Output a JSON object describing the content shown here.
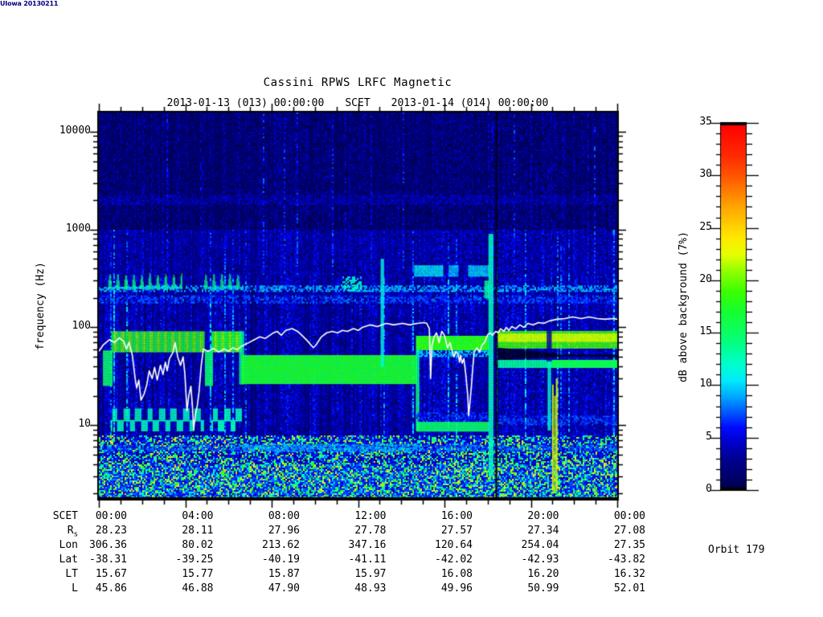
{
  "header": {
    "title": "Cassini RPWS LRFC Magnetic",
    "scet_left": "2013-01-13 (013) 00:00:00",
    "scet_label": "SCET",
    "scet_right": "2013-01-14 (014) 00:00:00"
  },
  "y_axis": {
    "label": "frequency (Hz)",
    "ticks": [
      {
        "value": 10000,
        "label": "10000"
      },
      {
        "value": 1000,
        "label": "1000"
      },
      {
        "value": 100,
        "label": "100"
      },
      {
        "value": 10,
        "label": "10"
      }
    ]
  },
  "colorbar": {
    "label": "dB above background (7%)",
    "range": [
      0,
      35
    ],
    "major_tick_step": 5,
    "minor_tick_step": 1,
    "tick_labels": [
      {
        "value": 35,
        "label": "35"
      },
      {
        "value": 30,
        "label": "30"
      },
      {
        "value": 25,
        "label": "25"
      },
      {
        "value": 20,
        "label": "20"
      },
      {
        "value": 15,
        "label": "15"
      },
      {
        "value": 10,
        "label": "10"
      },
      {
        "value": 5,
        "label": "5"
      },
      {
        "value": 0,
        "label": "0"
      }
    ]
  },
  "ephemeris_table": {
    "rows": [
      {
        "label": "SCET",
        "values": [
          "00:00",
          "04:00",
          "08:00",
          "12:00",
          "16:00",
          "20:00",
          "00:00"
        ]
      },
      {
        "label": "R",
        "label_sub": "s",
        "values": [
          "28.23",
          "28.11",
          "27.96",
          "27.78",
          "27.57",
          "27.34",
          "27.08"
        ]
      },
      {
        "label": "Lon",
        "values": [
          "306.36",
          "80.02",
          "213.62",
          "347.16",
          "120.64",
          "254.04",
          "27.35"
        ]
      },
      {
        "label": "Lat",
        "values": [
          "-38.31",
          "-39.25",
          "-40.19",
          "-41.11",
          "-42.02",
          "-42.93",
          "-43.82"
        ]
      },
      {
        "label": "LT",
        "values": [
          "15.67",
          "15.77",
          "15.87",
          "15.97",
          "16.08",
          "16.20",
          "16.32"
        ]
      },
      {
        "label": "L",
        "values": [
          "45.86",
          "46.88",
          "47.90",
          "48.93",
          "49.96",
          "50.99",
          "52.01"
        ]
      }
    ]
  },
  "annotations": {
    "orbit": "Orbit 179",
    "credit": "UIowa 20130211"
  },
  "chart_data": {
    "type": "heatmap",
    "title": "Cassini RPWS LRFC Magnetic",
    "xlabel": "SCET",
    "ylabel": "frequency (Hz)",
    "y_scale": "log",
    "x_range_hours": [
      0,
      24
    ],
    "x_major_tick_hours": [
      0,
      4,
      8,
      12,
      16,
      20,
      24
    ],
    "x_minor_tick_step_hours": 1,
    "y_range_hz": [
      1.8,
      15700
    ],
    "colorbar_label": "dB above background (7%)",
    "colorbar_range": [
      0,
      35
    ],
    "palette_stops": [
      [
        0,
        0,
        0,
        70
      ],
      [
        1.2,
        0,
        0,
        105
      ],
      [
        3,
        0,
        0,
        145
      ],
      [
        4.5,
        0,
        0,
        200
      ],
      [
        6,
        0,
        10,
        255
      ],
      [
        7.5,
        0,
        90,
        255
      ],
      [
        9,
        0,
        170,
        255
      ],
      [
        10.5,
        0,
        235,
        250
      ],
      [
        12,
        0,
        255,
        205
      ],
      [
        13.5,
        0,
        255,
        150
      ],
      [
        15,
        10,
        255,
        100
      ],
      [
        17,
        20,
        255,
        50
      ],
      [
        19,
        60,
        255,
        0
      ],
      [
        21,
        150,
        255,
        0
      ],
      [
        22.5,
        230,
        255,
        0
      ],
      [
        24,
        255,
        235,
        0
      ],
      [
        26,
        255,
        190,
        0
      ],
      [
        28,
        255,
        140,
        0
      ],
      [
        30,
        255,
        85,
        0
      ],
      [
        32,
        255,
        40,
        0
      ],
      [
        35,
        255,
        0,
        0
      ]
    ],
    "bands": [
      {
        "t0": 0,
        "t1": 24,
        "f0": 180,
        "f1": 212,
        "db": 7,
        "style": "speckle"
      },
      {
        "t0": 0,
        "t1": 24,
        "f0": 238,
        "f1": 268,
        "db": 9,
        "style": "speckle"
      },
      {
        "t0": 0,
        "t1": 24,
        "f0": 1850,
        "f1": 2250,
        "db": 4.2,
        "style": "speckle"
      },
      {
        "t0": 0,
        "t1": 24,
        "f0": 5.5,
        "f1": 6.3,
        "db": 7.5,
        "style": "speckle"
      },
      {
        "t0": 6.65,
        "t1": 14.72,
        "f0": 5.5,
        "f1": 6.4,
        "db": 9,
        "style": "speckle"
      },
      {
        "t0": 11.2,
        "t1": 12.15,
        "f0": 240,
        "f1": 330,
        "db": 12,
        "style": "speckle"
      },
      {
        "t0": 0.4,
        "t1": 3.85,
        "f0": 250,
        "f1": 362,
        "db": 13,
        "style": "wave",
        "period": 0.37
      },
      {
        "t0": 4.85,
        "t1": 6.7,
        "f0": 250,
        "f1": 362,
        "db": 13,
        "style": "wave",
        "period": 0.37
      },
      {
        "t0": 0.19,
        "t1": 0.63,
        "f0": 26,
        "f1": 58,
        "db": 15,
        "style": "solid"
      },
      {
        "t0": 4.91,
        "t1": 5.28,
        "f0": 26,
        "f1": 58,
        "db": 15,
        "style": "solid"
      },
      {
        "t0": 0.58,
        "t1": 4.84,
        "f0": 57,
        "f1": 91,
        "db": 17,
        "style": "blobs",
        "period": 0.33
      },
      {
        "t0": 5.21,
        "t1": 6.6,
        "f0": 57,
        "f1": 91,
        "db": 17,
        "style": "blobs",
        "period": 0.33
      },
      {
        "t0": 0.55,
        "t1": 4.84,
        "f0": 8.7,
        "f1": 14.8,
        "db": 12.5,
        "style": "sq",
        "period": 0.55
      },
      {
        "t0": 5.21,
        "t1": 6.6,
        "f0": 8.7,
        "f1": 14.8,
        "db": 12.5,
        "style": "sq",
        "period": 0.55
      },
      {
        "t0": 6.5,
        "t1": 6.68,
        "f0": 27,
        "f1": 91,
        "db": 14,
        "style": "solid"
      },
      {
        "t0": 6.62,
        "t1": 14.72,
        "f0": 27,
        "f1": 52,
        "db": 17,
        "style": "solid"
      },
      {
        "t0": 14.68,
        "t1": 14.82,
        "f0": 9,
        "f1": 82,
        "db": 14,
        "style": "solid"
      },
      {
        "t0": 14.7,
        "t1": 18.02,
        "f0": 60,
        "f1": 82,
        "db": 18,
        "style": "solid"
      },
      {
        "t0": 14.7,
        "t1": 18.02,
        "f0": 50,
        "f1": 58,
        "db": 10,
        "style": "speckle"
      },
      {
        "t0": 14.7,
        "t1": 18.02,
        "f0": 11.2,
        "f1": 13.6,
        "db": 6.5,
        "style": "speckle"
      },
      {
        "t0": 14.7,
        "t1": 18.02,
        "f0": 8.8,
        "f1": 10.8,
        "db": 15,
        "style": "solid"
      },
      {
        "t0": 14.6,
        "t1": 15.9,
        "f0": 340,
        "f1": 430,
        "db": 10.5,
        "style": "solid"
      },
      {
        "t0": 16.2,
        "t1": 16.6,
        "f0": 340,
        "f1": 430,
        "db": 9.5,
        "style": "solid"
      },
      {
        "t0": 17.1,
        "t1": 18.0,
        "f0": 340,
        "f1": 430,
        "db": 10,
        "style": "solid"
      },
      {
        "t0": 17.85,
        "t1": 18.05,
        "f0": 200,
        "f1": 300,
        "db": 13.5,
        "style": "solid"
      },
      {
        "t0": 13.05,
        "t1": 13.13,
        "f0": 40,
        "f1": 500,
        "db": 11.5,
        "style": "solid"
      },
      {
        "t0": 18.04,
        "t1": 18.22,
        "f0": 3,
        "f1": 900,
        "db": 12.5,
        "style": "solid"
      },
      {
        "t0": 18.48,
        "t1": 24,
        "f0": 62,
        "f1": 92,
        "db": 19,
        "style": "solid"
      },
      {
        "t0": 18.48,
        "t1": 24,
        "f0": 72,
        "f1": 86,
        "db": 22.5,
        "style": "solid"
      },
      {
        "t0": 18.48,
        "t1": 24,
        "f0": 39,
        "f1": 46.5,
        "db": 13.5,
        "style": "solid"
      },
      {
        "t0": 21,
        "t1": 24,
        "f0": 39,
        "f1": 46.5,
        "db": 16,
        "style": "solid"
      },
      {
        "t0": 18.5,
        "t1": 24,
        "f0": 10,
        "f1": 12.5,
        "db": 7,
        "style": "speckle"
      },
      {
        "t0": 20.74,
        "t1": 20.9,
        "f0": 45,
        "f1": 95,
        "db": 3.5,
        "style": "solid"
      },
      {
        "t0": 20.78,
        "t1": 20.87,
        "f0": 9,
        "f1": 45,
        "db": 12,
        "style": "solid"
      },
      {
        "t0": 20.98,
        "t1": 21.03,
        "f0": 2.2,
        "f1": 26,
        "db": 23,
        "style": "solid"
      },
      {
        "t0": 21.08,
        "t1": 21.12,
        "f0": 2.2,
        "f1": 20,
        "db": 21,
        "style": "solid"
      },
      {
        "t0": 21.16,
        "t1": 21.2,
        "f0": 2.2,
        "f1": 30,
        "db": 23,
        "style": "solid"
      }
    ],
    "black_wedge": {
      "t0": 18.48,
      "t1": 24,
      "taper_end": 21.5,
      "f_top_start": 62,
      "f_bot_start": 46.5,
      "f_top_end": 53,
      "f_bot_end": 50
    },
    "black_line": {
      "t0": 18.36,
      "t1": 18.44
    },
    "speckle_floor_max_hz": 8,
    "white_line_points": [
      [
        0,
        57
      ],
      [
        0.2,
        66
      ],
      [
        0.5,
        75
      ],
      [
        0.72,
        70
      ],
      [
        0.95,
        78
      ],
      [
        1.15,
        72
      ],
      [
        1.28,
        60
      ],
      [
        1.4,
        70
      ],
      [
        1.55,
        52
      ],
      [
        1.68,
        30
      ],
      [
        1.75,
        24
      ],
      [
        1.85,
        29
      ],
      [
        1.95,
        18
      ],
      [
        2.1,
        21
      ],
      [
        2.22,
        26
      ],
      [
        2.33,
        36
      ],
      [
        2.47,
        30
      ],
      [
        2.58,
        39
      ],
      [
        2.7,
        29
      ],
      [
        2.85,
        41
      ],
      [
        2.97,
        33
      ],
      [
        3.08,
        44
      ],
      [
        3.16,
        36
      ],
      [
        3.27,
        48
      ],
      [
        3.42,
        55
      ],
      [
        3.53,
        70
      ],
      [
        3.65,
        50
      ],
      [
        3.78,
        41
      ],
      [
        3.9,
        50
      ],
      [
        3.98,
        34
      ],
      [
        4.08,
        14
      ],
      [
        4.16,
        20
      ],
      [
        4.26,
        25
      ],
      [
        4.33,
        16
      ],
      [
        4.39,
        9
      ],
      [
        4.46,
        12.5
      ],
      [
        4.56,
        16
      ],
      [
        4.64,
        22
      ],
      [
        4.74,
        41
      ],
      [
        4.84,
        60
      ],
      [
        5.05,
        57
      ],
      [
        5.3,
        61
      ],
      [
        5.55,
        56
      ],
      [
        5.8,
        60
      ],
      [
        6.0,
        57
      ],
      [
        6.2,
        62
      ],
      [
        6.4,
        59
      ],
      [
        6.6,
        64
      ],
      [
        6.95,
        70
      ],
      [
        7.2,
        75
      ],
      [
        7.45,
        80
      ],
      [
        7.7,
        77
      ],
      [
        8.05,
        87
      ],
      [
        8.25,
        91
      ],
      [
        8.45,
        83
      ],
      [
        8.65,
        93
      ],
      [
        8.95,
        97
      ],
      [
        9.2,
        91
      ],
      [
        9.4,
        83
      ],
      [
        9.65,
        73
      ],
      [
        9.93,
        62
      ],
      [
        10.05,
        66
      ],
      [
        10.3,
        80
      ],
      [
        10.55,
        88
      ],
      [
        10.8,
        91
      ],
      [
        11.05,
        88
      ],
      [
        11.28,
        93
      ],
      [
        11.5,
        91
      ],
      [
        11.8,
        97
      ],
      [
        12.0,
        93
      ],
      [
        12.2,
        100
      ],
      [
        12.55,
        106
      ],
      [
        12.9,
        102
      ],
      [
        13.3,
        110
      ],
      [
        13.65,
        106
      ],
      [
        14.05,
        110
      ],
      [
        14.4,
        106
      ],
      [
        14.75,
        110
      ],
      [
        15.05,
        112
      ],
      [
        15.18,
        110
      ],
      [
        15.3,
        97
      ],
      [
        15.36,
        30
      ],
      [
        15.42,
        65
      ],
      [
        15.52,
        80
      ],
      [
        15.63,
        88
      ],
      [
        15.75,
        70
      ],
      [
        15.88,
        91
      ],
      [
        16.0,
        83
      ],
      [
        16.14,
        62
      ],
      [
        16.26,
        70
      ],
      [
        16.37,
        55
      ],
      [
        16.45,
        50
      ],
      [
        16.52,
        57
      ],
      [
        16.63,
        53
      ],
      [
        16.7,
        44
      ],
      [
        16.74,
        52
      ],
      [
        16.82,
        43
      ],
      [
        16.9,
        48
      ],
      [
        17.0,
        31
      ],
      [
        17.08,
        20
      ],
      [
        17.12,
        12.5
      ],
      [
        17.19,
        18
      ],
      [
        17.26,
        27
      ],
      [
        17.3,
        36
      ],
      [
        17.37,
        55
      ],
      [
        17.5,
        62
      ],
      [
        17.63,
        56
      ],
      [
        17.74,
        66
      ],
      [
        17.86,
        70
      ],
      [
        18.0,
        84
      ],
      [
        18.12,
        88
      ],
      [
        18.23,
        83
      ],
      [
        18.37,
        91
      ],
      [
        18.49,
        88
      ],
      [
        18.6,
        97
      ],
      [
        18.75,
        91
      ],
      [
        18.86,
        100
      ],
      [
        18.98,
        93
      ],
      [
        19.12,
        102
      ],
      [
        19.3,
        97
      ],
      [
        19.49,
        106
      ],
      [
        19.68,
        100
      ],
      [
        19.86,
        110
      ],
      [
        20.1,
        106
      ],
      [
        20.35,
        112
      ],
      [
        20.6,
        110
      ],
      [
        20.84,
        116
      ],
      [
        21.2,
        121
      ],
      [
        21.58,
        123
      ],
      [
        21.95,
        128
      ],
      [
        22.33,
        123
      ],
      [
        22.7,
        128
      ],
      [
        23.07,
        123
      ],
      [
        23.44,
        121
      ],
      [
        23.8,
        123
      ],
      [
        24,
        121
      ]
    ]
  }
}
